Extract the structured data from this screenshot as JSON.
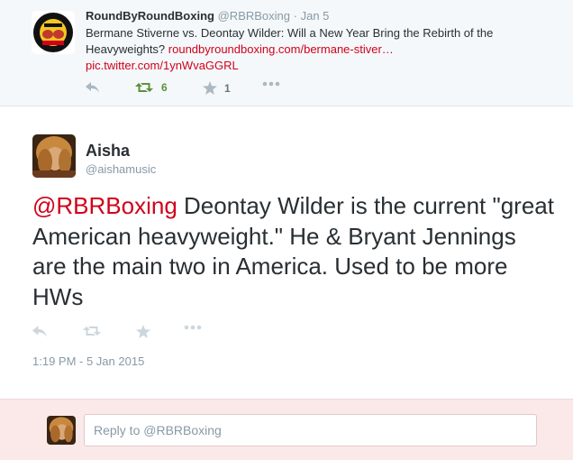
{
  "parent_tweet": {
    "name": "RoundByRoundBoxing",
    "handle": "@RBRBoxing",
    "separator": "·",
    "date": "Jan 5",
    "text": "Bermane Stiverne vs. Deontay Wilder: Will a New Year Bring the Rebirth of the Heavyweights?",
    "link": "roundbyroundboxing.com/bermane-stiver…",
    "pic_link": "pic.twitter.com/1ynWvaGGRL",
    "avatar_text": "ROUND BY ROUND BOXING",
    "retweet_count": "6",
    "favorite_count": "1",
    "icons": {
      "reply": "reply-icon",
      "retweet": "retweet-icon",
      "favorite": "star-icon",
      "more": "more-icon"
    }
  },
  "tweet": {
    "name": "Aisha",
    "handle": "@aishamusic",
    "mention": "@RBRBoxing",
    "text": " Deontay Wilder is the current \"great American heavyweight.\" He & Bryant Jennings are the main two in America. Used to be more HWs",
    "timestamp": "1:19 PM - 5 Jan 2015"
  },
  "reply": {
    "placeholder": "Reply to @RBRBoxing"
  },
  "colors": {
    "link": "#d0021b",
    "retweet_active": "#5c913b",
    "muted": "#8899a6",
    "reply_bg": "#fbe9ea"
  }
}
